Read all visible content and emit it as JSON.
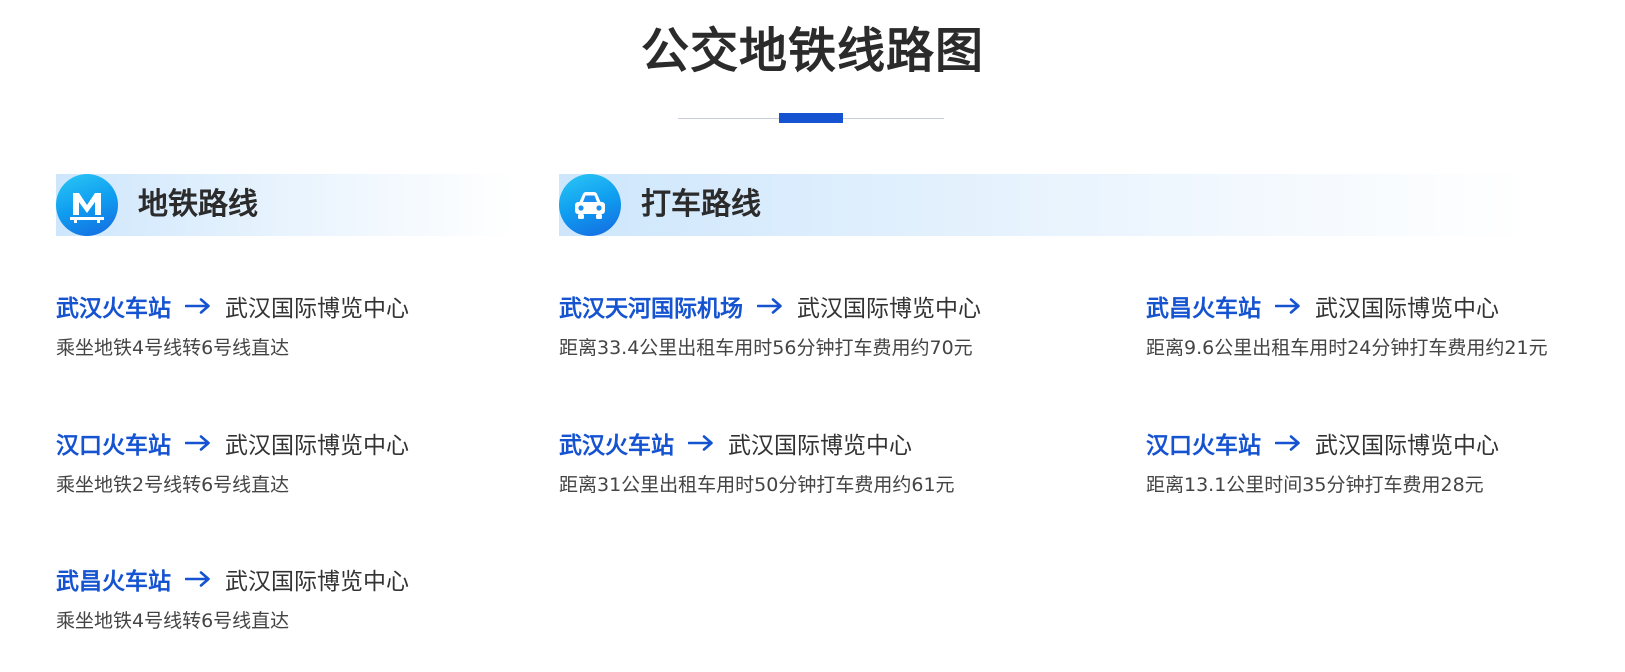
{
  "page_title": "公交地铁线路图",
  "colors": {
    "accent": "#1553d0",
    "icon_gradient_start": "#2bc7f5",
    "icon_gradient_end": "#1568e0"
  },
  "metro": {
    "title": "地铁路线",
    "icon": "metro-m-icon",
    "routes": [
      {
        "from": "武汉火车站",
        "to": "武汉国际博览中心",
        "desc": "乘坐地铁4号线转6号线直达"
      },
      {
        "from": "汉口火车站",
        "to": "武汉国际博览中心",
        "desc": "乘坐地铁2号线转6号线直达"
      },
      {
        "from": "武昌火车站",
        "to": "武汉国际博览中心",
        "desc": "乘坐地铁4号线转6号线直达"
      }
    ]
  },
  "taxi": {
    "title": "打车路线",
    "icon": "car-icon",
    "routes": [
      {
        "from": "武汉天河国际机场",
        "to": "武汉国际博览中心",
        "desc": "距离33.4公里出租车用时56分钟打车费用约70元"
      },
      {
        "from": "武汉火车站",
        "to": "武汉国际博览中心",
        "desc": "距离31公里出租车用时50分钟打车费用约61元"
      },
      {
        "from": "武昌火车站",
        "to": "武汉国际博览中心",
        "desc": "距离9.6公里出租车用时24分钟打车费用约21元"
      },
      {
        "from": "汉口火车站",
        "to": "武汉国际博览中心",
        "desc": "距离13.1公里时间35分钟打车费用28元"
      }
    ]
  }
}
